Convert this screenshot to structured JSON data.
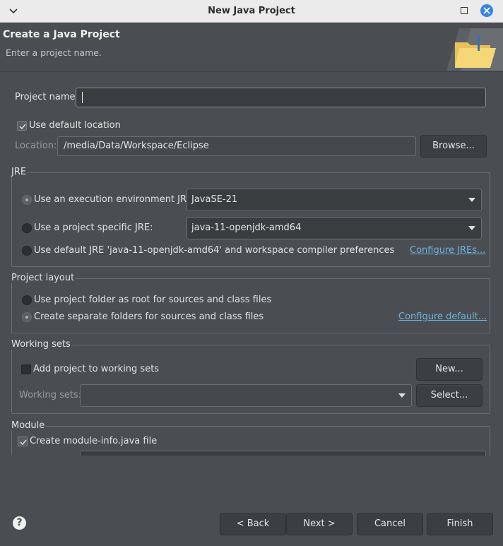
{
  "window": {
    "title": "New Java Project"
  },
  "header": {
    "title": "Create a Java Project",
    "subtitle": "Enter a project name."
  },
  "project": {
    "name_label": "Project name:",
    "name_value": "",
    "use_default_location_label": "Use default location",
    "use_default_location_checked": true,
    "location_label": "Location:",
    "location_value": "/media/Data/Workspace/Eclipse",
    "browse_label": "Browse..."
  },
  "jre": {
    "group_label": "JRE",
    "option_env_label": "Use an execution environment JRE:",
    "option_env_value": "JavaSE-21",
    "option_specific_label": "Use a project specific JRE:",
    "option_specific_value": "java-11-openjdk-amd64",
    "option_default_label": "Use default JRE 'java-11-openjdk-amd64' and workspace compiler preferences",
    "configure_link": "Configure JREs...",
    "selected": "env"
  },
  "layout": {
    "group_label": "Project layout",
    "option_root_label": "Use project folder as root for sources and class files",
    "option_separate_label": "Create separate folders for sources and class files",
    "configure_link": "Configure default...",
    "selected": "separate"
  },
  "working_sets": {
    "group_label": "Working sets",
    "add_label": "Add project to working sets",
    "add_checked": false,
    "new_label": "New...",
    "sets_label": "Working sets:",
    "sets_value": "",
    "select_label": "Select..."
  },
  "module": {
    "group_label": "Module",
    "create_label": "Create module-info.java file",
    "create_checked": true
  },
  "footer": {
    "help_glyph": "?",
    "back_label": "< Back",
    "next_label": "Next >",
    "cancel_label": "Cancel",
    "finish_label": "Finish"
  }
}
